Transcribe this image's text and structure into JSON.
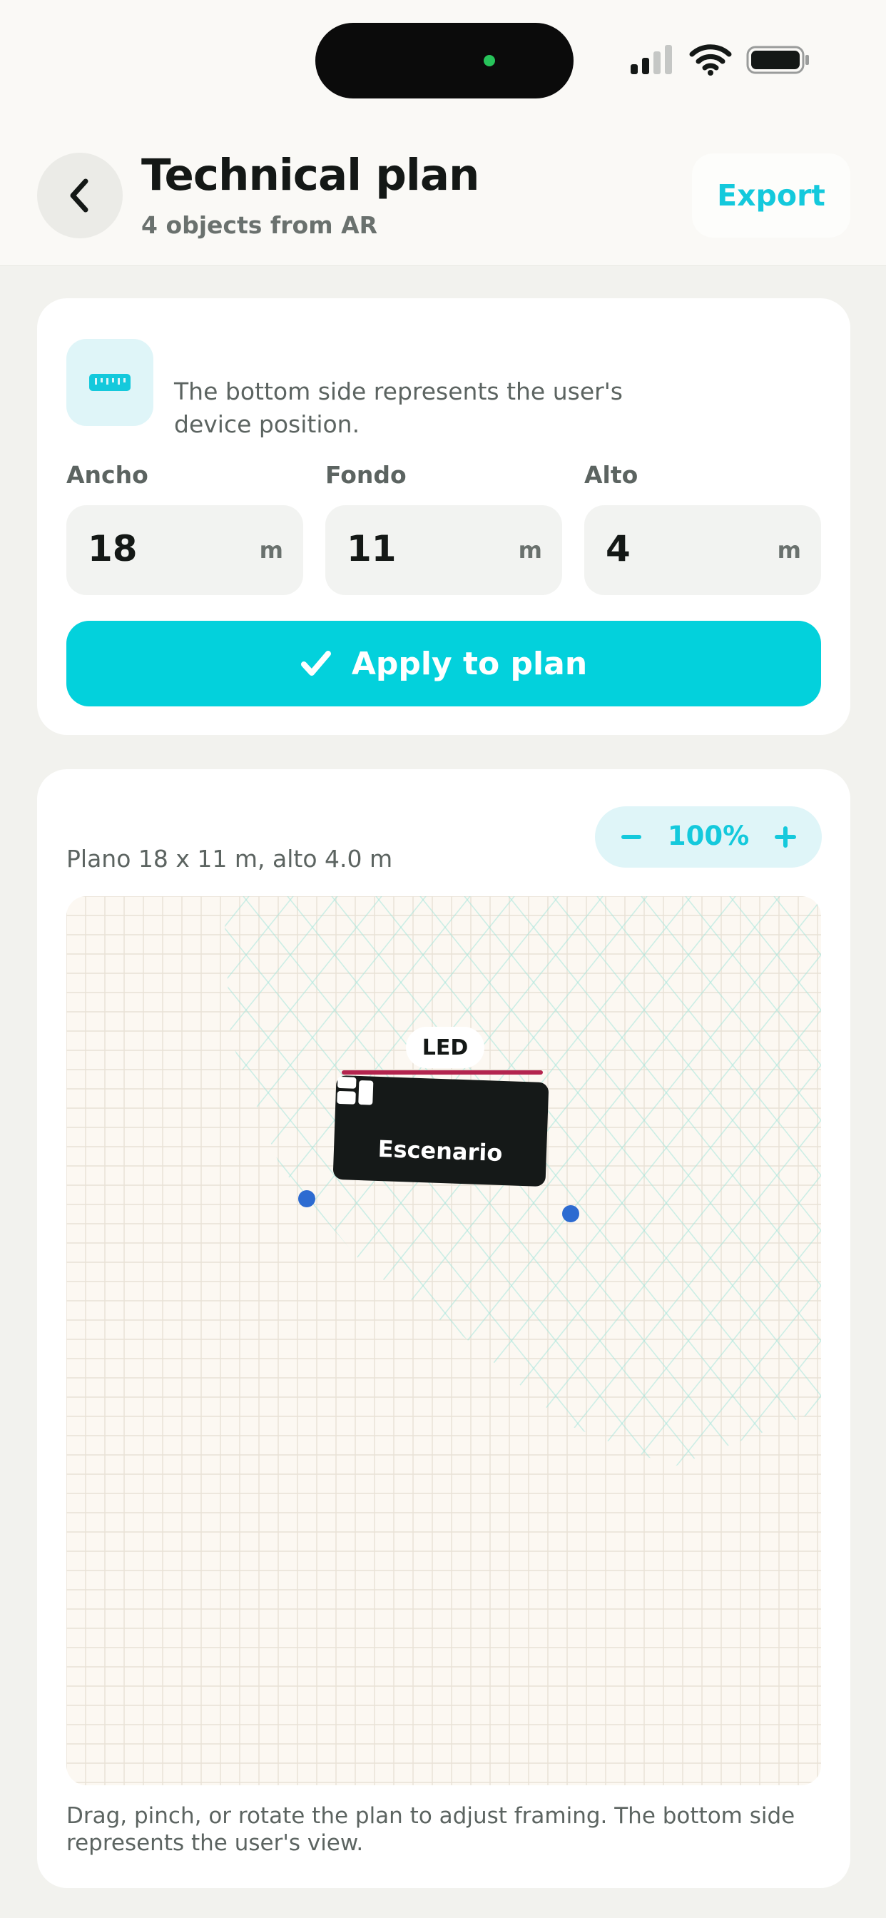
{
  "header": {
    "title": "Technical plan",
    "subtitle": "4 objects from AR",
    "export_label": "Export",
    "back_icon": "chevron-left-icon"
  },
  "dimensions": {
    "info": "The bottom side represents the user's device position.",
    "info_icon": "ruler-icon",
    "fields": [
      {
        "label": "Ancho",
        "value": "18",
        "unit": "m"
      },
      {
        "label": "Fondo",
        "value": "11",
        "unit": "m"
      },
      {
        "label": "Alto",
        "value": "4",
        "unit": "m"
      }
    ],
    "apply_label": "Apply to plan",
    "apply_icon": "checkmark-icon"
  },
  "plan": {
    "caption": "Plano 18 x 11 m, alto 4.0 m",
    "zoom": "100%",
    "zoom_minus": "−",
    "zoom_plus": "+",
    "objects": {
      "led_label": "LED",
      "stage_label": "Escenario",
      "stage_icon": "blocks-icon"
    },
    "footer": "Drag, pinch, or rotate the plan to adjust framing. The bottom side represents the user's view."
  },
  "colors": {
    "accent": "#03d1dc",
    "accent_text": "#14c9dc",
    "led": "#b3244e",
    "stage": "#151918",
    "handle": "#2d6bd1",
    "canvas": "#fcf8f2"
  }
}
